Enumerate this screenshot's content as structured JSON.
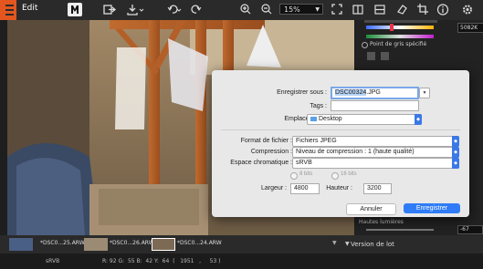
{
  "app": {
    "title": "Edit"
  },
  "toolbar": {
    "zoom": "15%"
  },
  "right_panel": {
    "temperature": "5082K",
    "gray_point_label": "Point de gris spécifié",
    "highlights_label": "Hautes lumières",
    "highlights_value": "-67",
    "batch_label": "Version de lot"
  },
  "filmstrip": {
    "items": [
      {
        "label": "*DSC0...25.ARW"
      },
      {
        "label": "*DSC0...26.ARW"
      },
      {
        "label": "*DSC0...24.ARW"
      }
    ]
  },
  "status": {
    "colorspace": "sRVB",
    "readout": "R: 92 G:  55 B:  42 Y:  64  (   1951   ,     53 )"
  },
  "dialog": {
    "save_as_label": "Enregistrer sous :",
    "filename_selected": "DSC00324",
    "filename_ext": ".JPG",
    "tags_label": "Tags :",
    "tags_value": "",
    "location_label": "Emplacement :",
    "location_value": "Desktop",
    "format_label": "Format de fichier :",
    "format_value": "Fichiers JPEG",
    "compression_label": "Compression :",
    "compression_value": "Niveau de compression : 1 (haute qualité)",
    "colorspace_label": "Espace chromatique :",
    "colorspace_value": "sRVB",
    "bits8": "8 bits",
    "bits16": "16 bits",
    "width_label": "Largeur :",
    "width_value": "4800",
    "height_label": "Hauteur :",
    "height_value": "3200",
    "cancel": "Annuler",
    "save": "Enregistrer"
  }
}
